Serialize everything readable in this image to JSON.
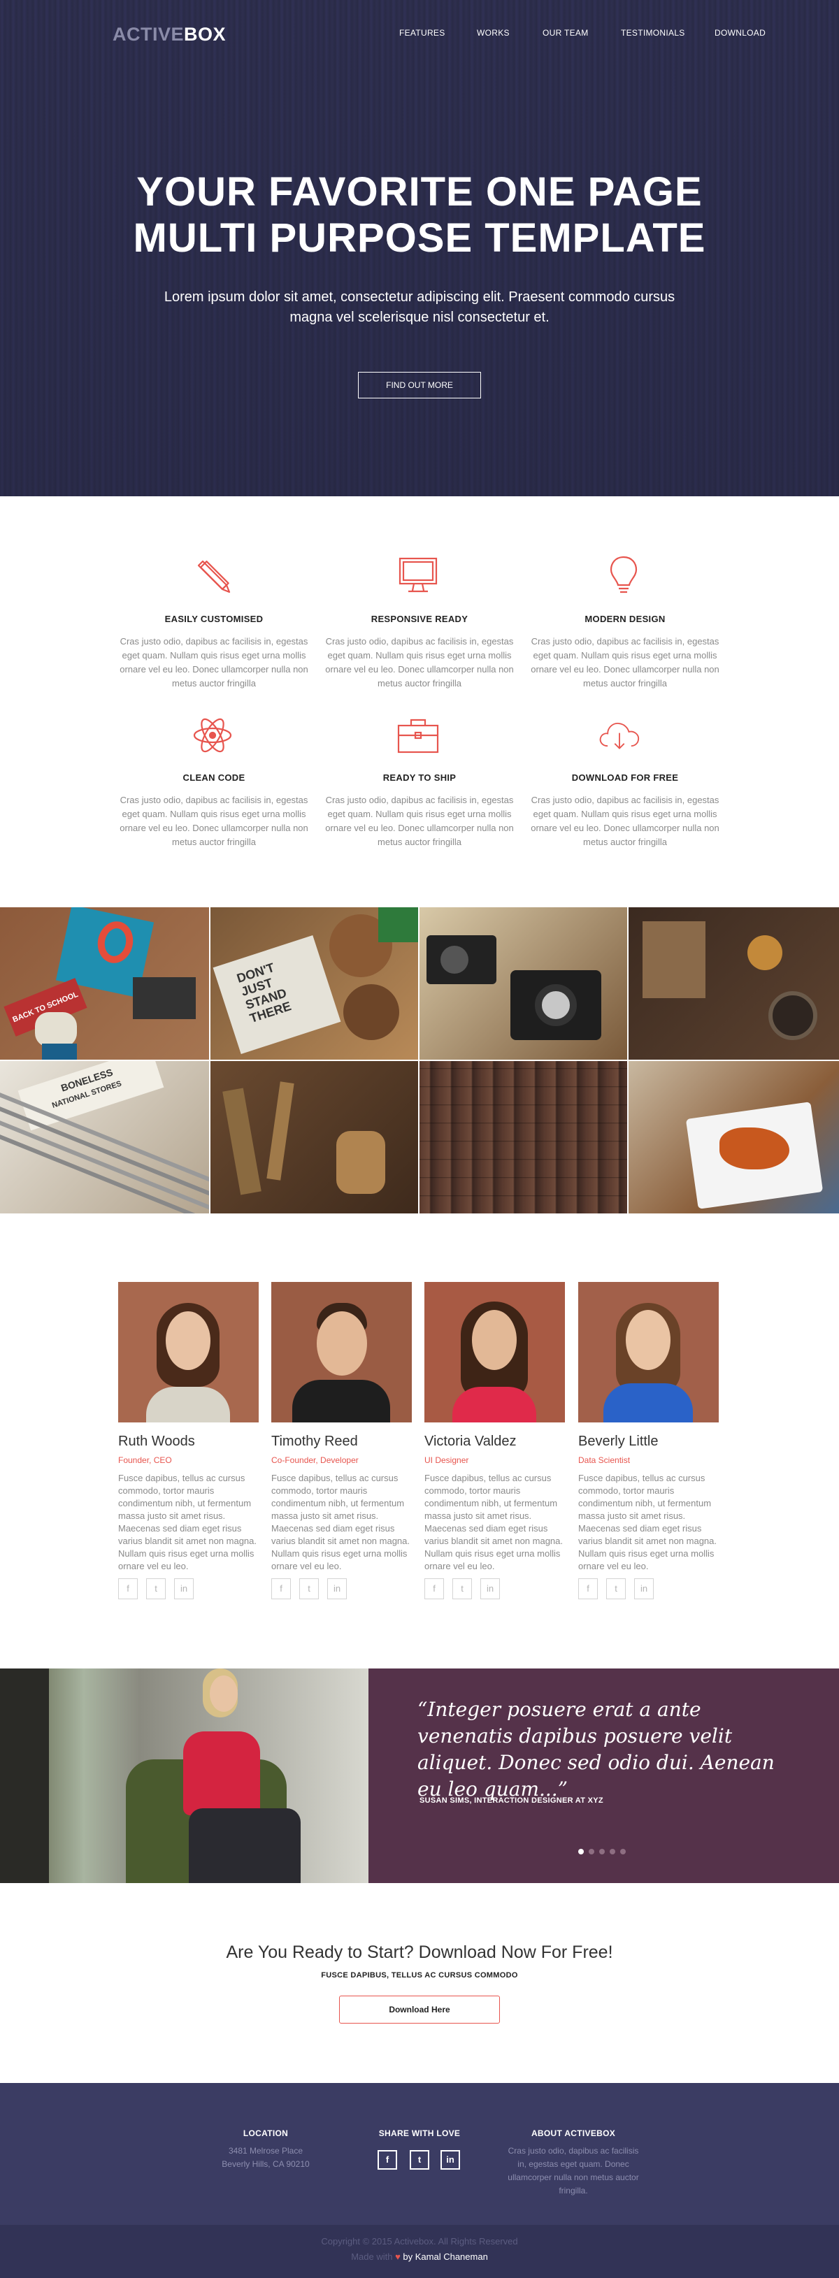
{
  "colors": {
    "accent": "#e7554e",
    "hero_bg": "#2e2f4d",
    "testimonial_bg": "#55324a",
    "footer_bg": "#3b3c63",
    "footer_bottom_bg": "#323356"
  },
  "header": {
    "logo_part1": "ACTIVE",
    "logo_part2": "BOX",
    "nav": [
      "FEATURES",
      "WORKS",
      "OUR TEAM",
      "TESTIMONIALS",
      "DOWNLOAD"
    ]
  },
  "hero": {
    "title_line1": "YOUR FAVORITE ONE PAGE",
    "title_line2": "MULTI PURPOSE TEMPLATE",
    "subtitle": "Lorem ipsum dolor sit amet, consectetur adipiscing elit. Praesent commodo cursus magna vel scelerisque nisl consectetur et.",
    "button": "FIND OUT MORE"
  },
  "features": [
    {
      "icon": "pencil-ruler-icon",
      "title": "EASILY CUSTOMISED",
      "desc": "Cras justo odio, dapibus ac facilisis in, egestas eget quam. Nullam quis risus eget urna mollis ornare vel eu leo. Donec ullamcorper nulla non metus auctor fringilla"
    },
    {
      "icon": "monitor-icon",
      "title": "RESPONSIVE READY",
      "desc": "Cras justo odio, dapibus ac facilisis in, egestas eget quam. Nullam quis risus eget urna mollis ornare vel eu leo. Donec ullamcorper nulla non metus auctor fringilla"
    },
    {
      "icon": "lightbulb-icon",
      "title": "MODERN DESIGN",
      "desc": "Cras justo odio, dapibus ac facilisis in, egestas eget quam. Nullam quis risus eget urna mollis ornare vel eu leo. Donec ullamcorper nulla non metus auctor fringilla"
    },
    {
      "icon": "atom-icon",
      "title": "CLEAN CODE",
      "desc": "Cras justo odio, dapibus ac facilisis in, egestas eget quam. Nullam quis risus eget urna mollis ornare vel eu leo. Donec ullamcorper nulla non metus auctor fringilla"
    },
    {
      "icon": "briefcase-icon",
      "title": "READY TO SHIP",
      "desc": "Cras justo odio, dapibus ac facilisis in, egestas eget quam. Nullam quis risus eget urna mollis ornare vel eu leo. Donec ullamcorper nulla non metus auctor fringilla"
    },
    {
      "icon": "cloud-download-icon",
      "title": "DOWNLOAD FOR FREE",
      "desc": "Cras justo odio, dapibus ac facilisis in, egestas eget quam. Nullam quis risus eget urna mollis ornare vel eu leo. Donec ullamcorper nulla non metus auctor fringilla"
    }
  ],
  "gallery_text": {
    "poster_line1": "DON'T",
    "poster_line2": "JUST",
    "poster_line3": "STAND",
    "poster_line4": "THERE",
    "banner": "BACK TO SCHOOL",
    "pencil_label": "BONELESS",
    "pencil_label2": "NATIONAL STORES"
  },
  "team": [
    {
      "name": "Ruth Woods",
      "role": "Founder, CEO",
      "bio": "Fusce dapibus, tellus ac cursus commodo, tortor mauris condimentum nibh, ut fermentum massa justo sit amet risus. Maecenas sed diam eget risus varius blandit sit amet non magna. Nullam quis risus eget urna mollis ornare vel eu leo."
    },
    {
      "name": "Timothy Reed",
      "role": "Co-Founder, Developer",
      "bio": "Fusce dapibus, tellus ac cursus commodo, tortor mauris condimentum nibh, ut fermentum massa justo sit amet risus. Maecenas sed diam eget risus varius blandit sit amet non magna. Nullam quis risus eget urna mollis ornare vel eu leo."
    },
    {
      "name": "Victoria Valdez",
      "role": "UI Designer",
      "bio": "Fusce dapibus, tellus ac cursus commodo, tortor mauris condimentum nibh, ut fermentum massa justo sit amet risus. Maecenas sed diam eget risus varius blandit sit amet non magna. Nullam quis risus eget urna mollis ornare vel eu leo."
    },
    {
      "name": "Beverly Little",
      "role": "Data Scientist",
      "bio": "Fusce dapibus, tellus ac cursus commodo, tortor mauris condimentum nibh, ut fermentum massa justo sit amet risus. Maecenas sed diam eget risus varius blandit sit amet non magna. Nullam quis risus eget urna mollis ornare vel eu leo."
    }
  ],
  "social_icons": [
    "facebook-icon",
    "twitter-icon",
    "linkedin-icon"
  ],
  "social_glyphs": {
    "facebook": "f",
    "twitter": "t",
    "linkedin": "in"
  },
  "testimonial": {
    "quote": "“Integer posuere erat a ante venenatis dapibus posuere velit aliquet. Donec sed odio dui. Aenean eu leo quam...”",
    "author": "SUSAN SIMS, INTERACTION DESIGNER AT XYZ",
    "slide_count": 5,
    "active_slide": 1
  },
  "cta": {
    "title": "Are You Ready to Start? Download Now For Free!",
    "subtitle": "FUSCE DAPIBUS, TELLUS AC CURSUS COMMODO",
    "button": "Download Here"
  },
  "footer": {
    "location_title": "LOCATION",
    "address_line1": "3481 Melrose Place",
    "address_line2": "Beverly Hills, CA 90210",
    "share_title": "SHARE WITH LOVE",
    "about_title": "ABOUT ACTIVEBOX",
    "about_text": "Cras justo odio, dapibus ac facilisis in, egestas eget quam. Donec ullamcorper nulla non metus auctor fringilla.",
    "copyright": "Copyright © 2015 Activebox. All Rights Reserved",
    "made_with": "Made with",
    "made_by": "by Kamal Chaneman"
  }
}
